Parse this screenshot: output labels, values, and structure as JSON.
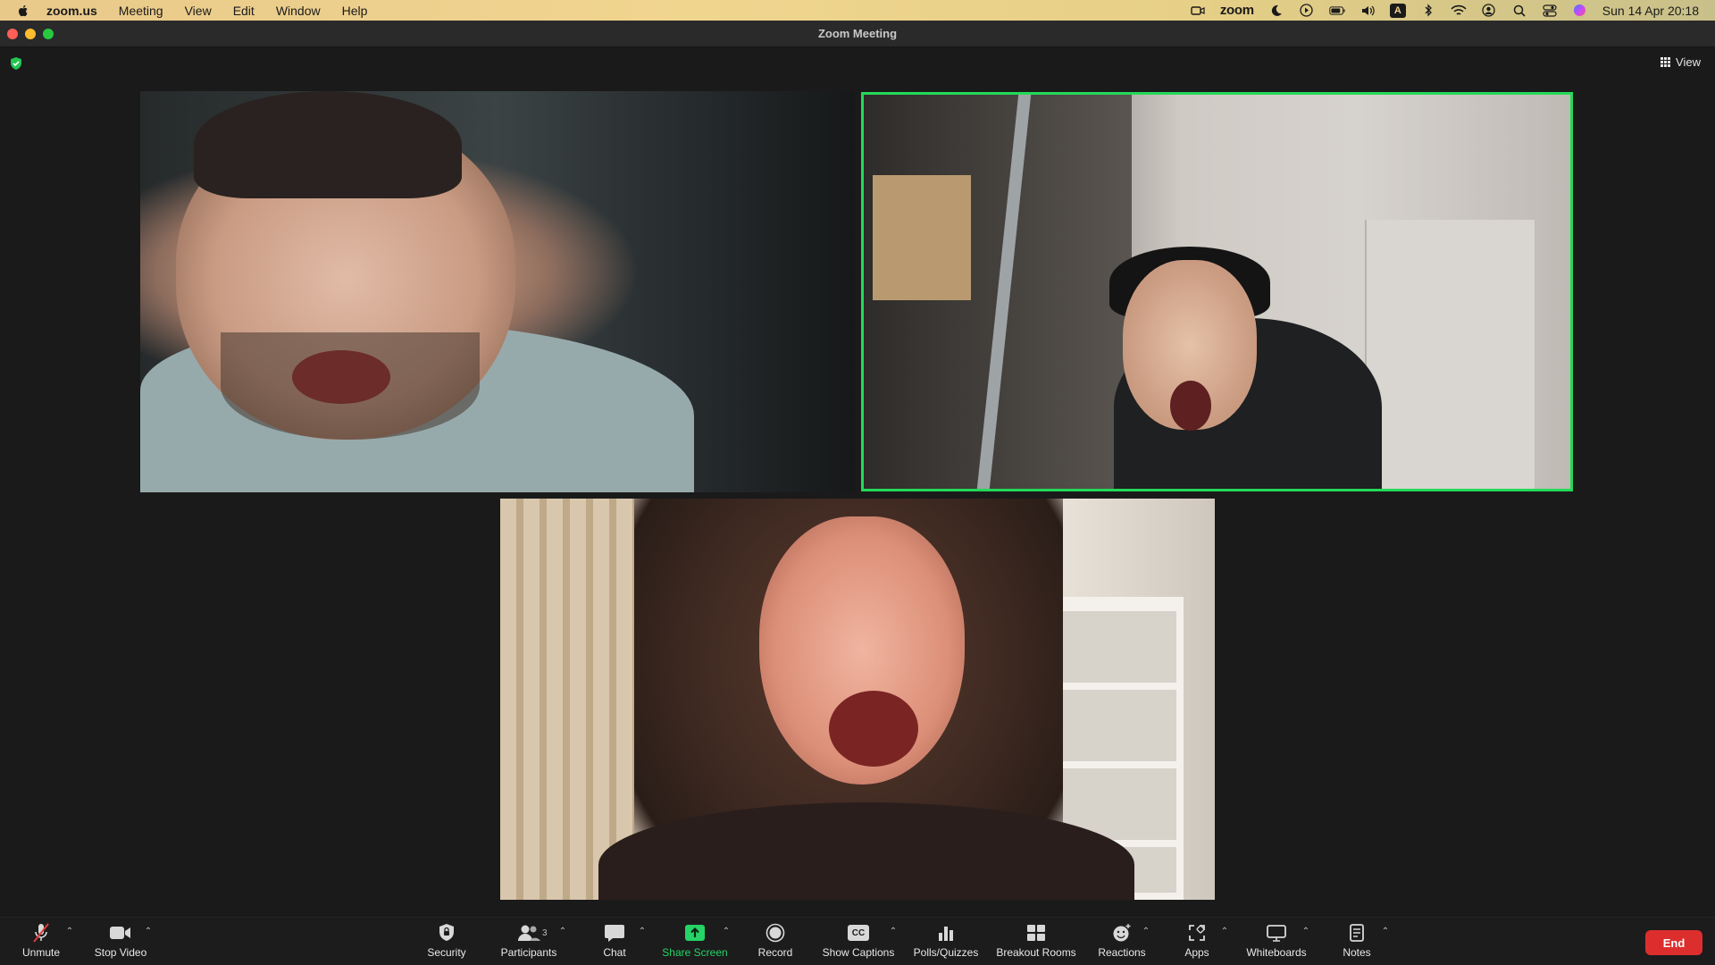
{
  "menubar": {
    "app_name": "zoom.us",
    "menus": [
      "Meeting",
      "View",
      "Edit",
      "Window",
      "Help"
    ],
    "zoom_label": "zoom",
    "input_badge": "A",
    "datetime": "Sun 14 Apr  20:18"
  },
  "window": {
    "title": "Zoom Meeting",
    "view_label": "View"
  },
  "colors": {
    "active_speaker_border": "#23d959",
    "end_button": "#dd2e2e",
    "share_screen": "#25d366"
  },
  "toolbar": {
    "unmute": "Unmute",
    "stop_video": "Stop Video",
    "security": "Security",
    "participants": "Participants",
    "participants_count": "3",
    "chat": "Chat",
    "share_screen": "Share Screen",
    "record": "Record",
    "show_captions": "Show Captions",
    "captions_icon_text": "CC",
    "polls": "Polls/Quizzes",
    "breakout_rooms": "Breakout Rooms",
    "reactions": "Reactions",
    "apps": "Apps",
    "whiteboards": "Whiteboards",
    "notes": "Notes",
    "end": "End"
  }
}
